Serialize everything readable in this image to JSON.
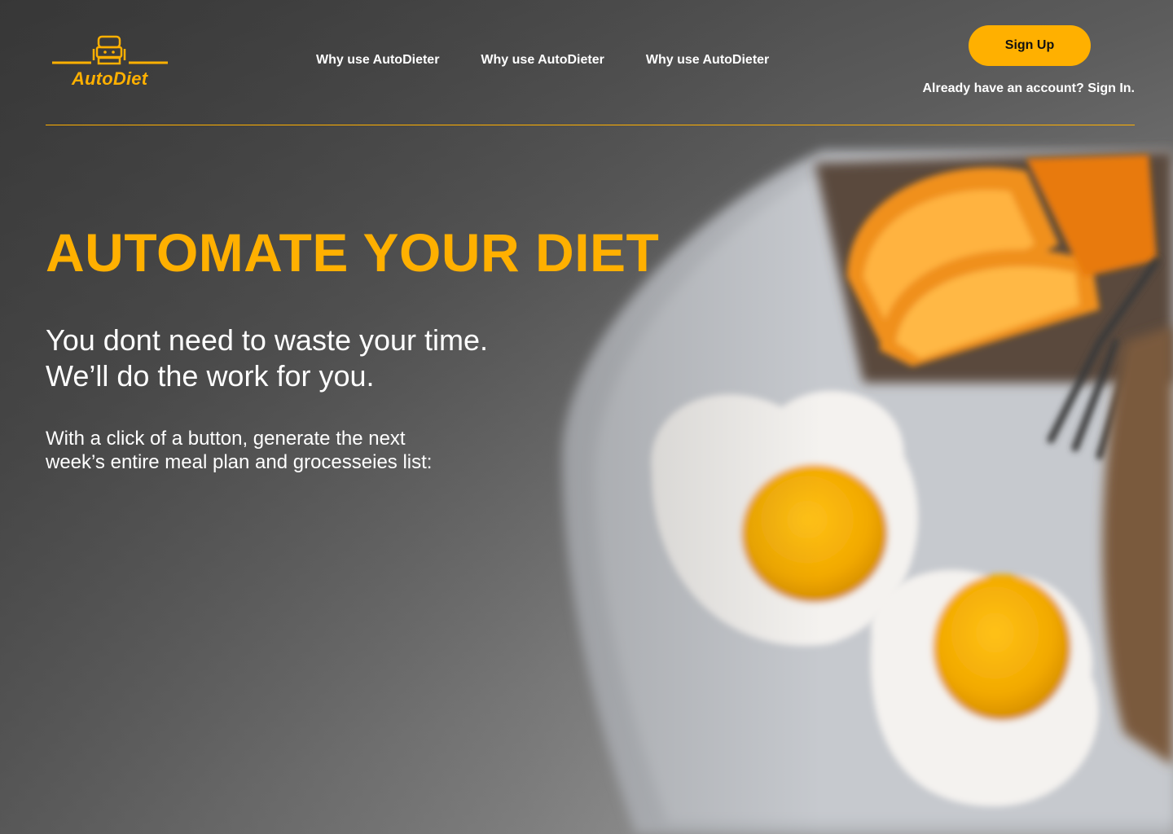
{
  "brand": {
    "name": "AutoDiet",
    "accent_color": "#ffb000",
    "logo_icon": "chef-robot-icon"
  },
  "nav": {
    "links": [
      {
        "label": "Why use AutoDieter"
      },
      {
        "label": "Why use AutoDieter"
      },
      {
        "label": "Why use AutoDieter"
      }
    ]
  },
  "auth": {
    "signup_label": "Sign Up",
    "signin_prompt": "Already have an account?",
    "signin_link": "Sign In."
  },
  "hero": {
    "title": "AUTOMATE YOUR DIET",
    "subtitle_line1": "You dont need to waste your time.",
    "subtitle_line2": "We’ll do the work for you.",
    "description_line1": "With a click of a button, generate the next",
    "description_line2": "week’s entire meal plan and grocesseies list:"
  },
  "background": {
    "image": "blurred-breakfast-photo",
    "items": [
      "orange-slices",
      "fried-eggs",
      "toast",
      "fork",
      "plate"
    ]
  }
}
